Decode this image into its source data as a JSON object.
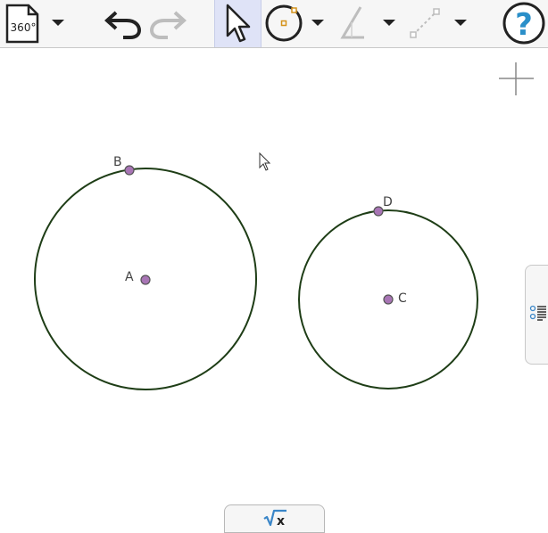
{
  "toolbar": {
    "app_menu_icon": "document-360-icon",
    "app_menu_label": "360°",
    "undo_icon": "undo-icon",
    "redo_icon": "redo-icon",
    "move_tool_icon": "arrow-cursor-icon",
    "circle_tool_icon": "circle-center-point-icon",
    "angle_tool_icon": "angle-icon",
    "segment_tool_icon": "dashed-segment-icon",
    "help_icon": "help-icon",
    "help_label": "?"
  },
  "canvas": {
    "zoom_icon": "plus-crosshair-icon",
    "points": [
      {
        "name": "A",
        "label": "A"
      },
      {
        "name": "B",
        "label": "B"
      },
      {
        "name": "C",
        "label": "C"
      },
      {
        "name": "D",
        "label": "D"
      }
    ],
    "colors": {
      "circle_stroke": "#1e3d16",
      "point_fill": "#a875b5",
      "point_stroke": "#555555",
      "selected_tool_bg": "#dfe3f7"
    }
  },
  "side_panel": {
    "toggle_icon": "algebra-list-icon"
  },
  "bottom_panel": {
    "toggle_icon": "sqrt-x-icon",
    "label": "x"
  }
}
